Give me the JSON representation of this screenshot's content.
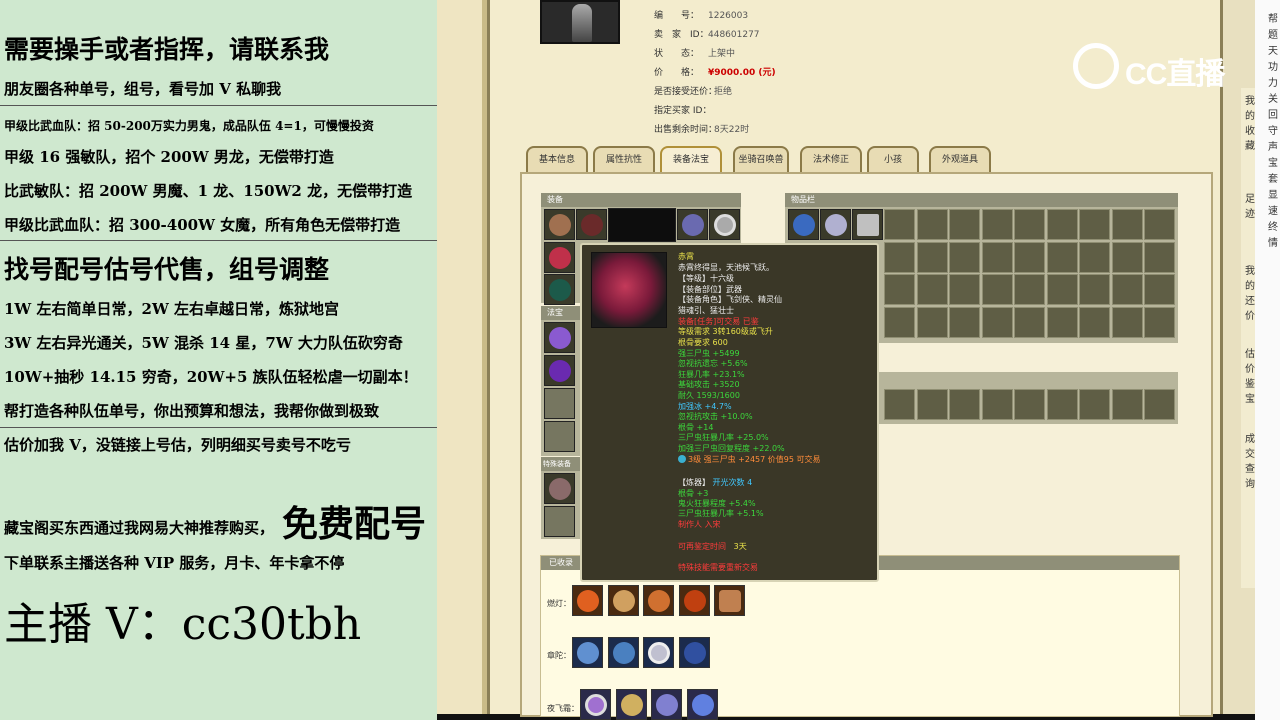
{
  "left_panel": {
    "title": "需要操手或者指挥，请联系我",
    "line1": "朋友圈各种单号，组号，看号加 V 私聊我",
    "line2": "甲级比武血队：招 50-200万实力男鬼，成品队伍 4=1，可慢慢投资",
    "line3": "甲级 16 强敏队，招个 200W 男龙，无偿带打造",
    "line4": "比武敏队：招 200W 男魔、1 龙、150W2 龙，无偿带打造",
    "line5": "甲级比武血队：招 300-400W 女魔，所有角色无偿带打造",
    "heading2": "找号配号估号代售，组号调整",
    "line6": "1W 左右简单日常，2W 左右卓越日常，炼狱地宫",
    "line7": "3W 左右异光通关，5W 混杀 14 星，7W 大力队伍砍穷奇",
    "line8": "10W+抽秒 14.15 穷奇，20W+5 族队伍轻松虐一切副本！",
    "line9": "帮打造各种队伍单号，你出预算和想法，我帮你做到极致",
    "line10": "估价加我 V，没链接上号估，列明细买号卖号不吃亏",
    "line11": "藏宝阁买东西通过我网易大神推荐购买，",
    "free_match": "免费配号",
    "line12": "下单联系主播送各种 VIP 服务，月卡、年卡拿不停",
    "contact": "主播 V：cc30tbh"
  },
  "listing": {
    "rows": [
      {
        "key": "编　　号：",
        "value": "1226003"
      },
      {
        "key": "卖　家　ID：",
        "value": "448601277"
      },
      {
        "key": "状　　态：",
        "value": "上架中"
      },
      {
        "key": "价　　格：",
        "value": "¥9000.00 (元)"
      },
      {
        "key": "是否接受还价：",
        "value": "拒绝"
      },
      {
        "key": "指定买家 ID：",
        "value": ""
      },
      {
        "key": "出售剩余时间：",
        "value": "8天22时"
      }
    ]
  },
  "tabs": [
    "基本信息",
    "属性抗性",
    "装备法宝",
    "坐骑召唤兽",
    "法术修正",
    "小孩",
    "外观道具"
  ],
  "active_tab": "装备法宝",
  "panels": {
    "equipment_title": "装备",
    "magic_title": "法宝",
    "special_title": "特殊装备",
    "inventory_title": "物品栏",
    "owned_title": "已收录",
    "owned_rows": [
      {
        "label": "燃灯："
      },
      {
        "label": "章陀："
      },
      {
        "label": "夜飞霜："
      }
    ]
  },
  "tooltip": {
    "name": "赤霄",
    "desc": "赤霄终得显，天池候飞跃。",
    "level": "【等级】十六级",
    "slot": "【装备部位】武器",
    "role": "【装备角色】飞剑侠、精灵仙",
    "role2": "猎魂引、猛壮士",
    "bound": "装备[任务]可交易 已鉴",
    "req_level": "等级需求 3转160级或飞升",
    "req_bone": "根骨要求 600",
    "attr1": "强三尸虫 +5499",
    "attr2": "忽视抗遗忘 +5.6%",
    "attr3": "狂暴几率 +23.1%",
    "attr4": "基础攻击 +3520",
    "attr5": "耐久 1593/1600",
    "attr6": "加强冰 +4.7%",
    "attr7": "忽视抗攻击 +10.0%",
    "attr8": "根骨 +14",
    "attr9": "三尸虫狂暴几率 +25.0%",
    "attr10": "加强三尸虫回复程度 +22.0%",
    "gem": "3级 强三尸虫 +2457 价值95 可交易",
    "refine_title": "【炼器】",
    "refine_count": "开光次数 4",
    "refine1": "根骨 +3",
    "refine2": "鬼火狂暴程度 +5.4%",
    "refine3": "三尸虫狂暴几率 +5.1%",
    "refine4": "制作人 入宋",
    "expire_label": "可再鉴定时间",
    "expire_value": "3天",
    "footer": "特殊技能需要重新交易"
  },
  "logo": {
    "text": "CC直播"
  },
  "right_sidebar": {
    "col1": [
      "帮",
      "题",
      "天",
      "功",
      "力",
      "关",
      "回",
      "守",
      "声",
      "宝",
      "套",
      "显",
      "速",
      "终",
      "情"
    ],
    "inner1": [
      "我",
      "的",
      "收",
      "藏"
    ],
    "inner2": [
      "足",
      "迹"
    ],
    "inner3": [
      "我",
      "的",
      "还",
      "价"
    ],
    "inner4": [
      "估",
      "价",
      "鉴",
      "宝"
    ],
    "inner5": [
      "成",
      "交",
      "查",
      "询"
    ]
  }
}
